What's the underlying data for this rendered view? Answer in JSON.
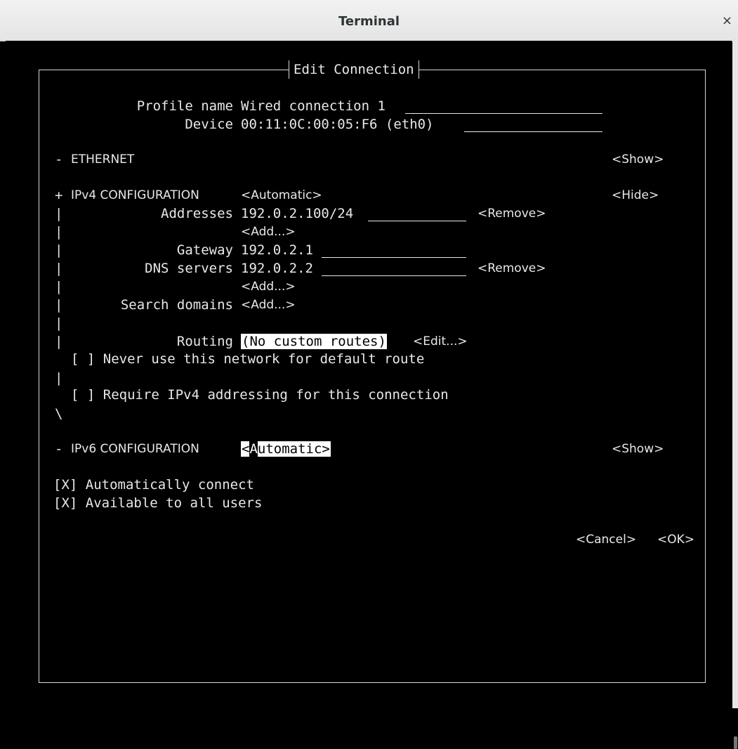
{
  "window": {
    "title": "Terminal",
    "close_glyph": "×"
  },
  "dialog": {
    "title": "Edit Connection"
  },
  "profile": {
    "label": "Profile name",
    "value": "Wired connection 1"
  },
  "device": {
    "label": "Device",
    "value": "00:11:0C:00:05:F6 (eth0)"
  },
  "ethernet": {
    "marker": "-",
    "label": "ETHERNET",
    "toggle": "<Show>"
  },
  "ipv4": {
    "marker": "+",
    "label": "IPv4 CONFIGURATION",
    "mode": "<Automatic>",
    "toggle": "<Hide>",
    "addresses_label": "Addresses",
    "addresses_value": "192.0.2.100/24",
    "remove": "<Remove>",
    "add": "<Add...>",
    "gateway_label": "Gateway",
    "gateway_value": "192.0.2.1",
    "dns_label": "DNS servers",
    "dns_value": "192.0.2.2",
    "search_label": "Search domains",
    "routing_label": "Routing",
    "routing_value": "(No custom routes)",
    "edit": "<Edit...>",
    "never_default": "[ ] Never use this network for default route",
    "require_ipv4": "[ ] Require IPv4 addressing for this connection"
  },
  "ipv6": {
    "marker": "-",
    "label": "IPv6 CONFIGURATION",
    "mode_first": "<",
    "mode_cursor": "A",
    "mode_rest": "utomatic>",
    "toggle": "<Show>"
  },
  "auto_connect": "[X] Automatically connect",
  "all_users": "[X] Available to all users",
  "buttons": {
    "cancel": "<Cancel>",
    "ok": "<OK>"
  },
  "tree_glyphs": {
    "bar": "|",
    "end": "\\"
  }
}
